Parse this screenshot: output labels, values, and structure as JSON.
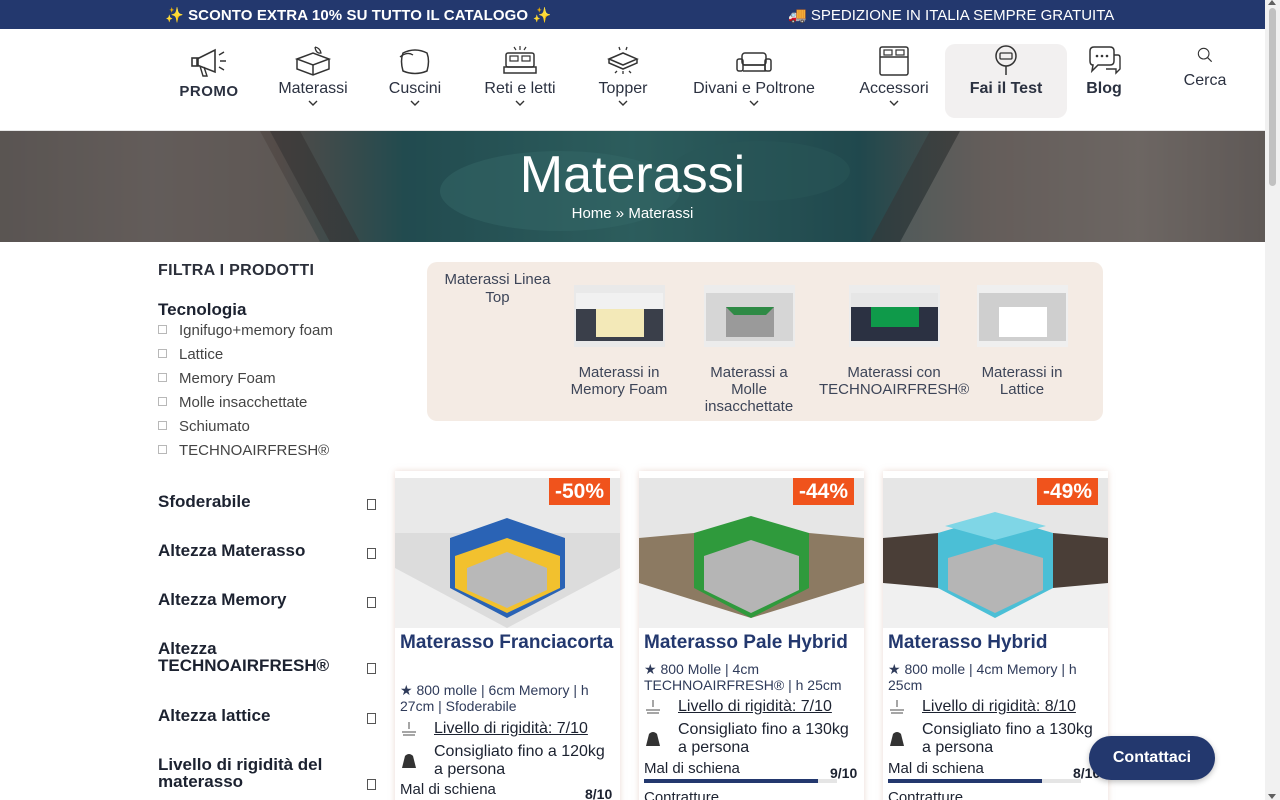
{
  "topbar": {
    "promo": "SCONTO EXTRA 10% SU TUTTO IL CATALOGO",
    "shipping": "SPEDIZIONE IN ITALIA SEMPRE GRATUITA",
    "spark": "✨",
    "truck": "🚚"
  },
  "nav": {
    "items": [
      {
        "label": "PROMO",
        "icon": "megaphone-icon"
      },
      {
        "label": "Materassi",
        "icon": "mattress-icon"
      },
      {
        "label": "Cuscini",
        "icon": "pillow-icon"
      },
      {
        "label": "Reti e letti",
        "icon": "bed-icon"
      },
      {
        "label": "Topper",
        "icon": "topper-icon"
      },
      {
        "label": "Divani e Poltrone",
        "icon": "sofa-icon"
      },
      {
        "label": "Accessori",
        "icon": "bed-frame-icon"
      },
      {
        "label": "Fai il Test",
        "icon": "sleep-test-icon"
      },
      {
        "label": "Blog",
        "icon": "chat-bubbles-icon"
      },
      {
        "label": "Cerca",
        "icon": "search-icon"
      }
    ]
  },
  "hero": {
    "title": "Materassi",
    "breadcrumb_home": "Home",
    "breadcrumb_sep": " » ",
    "breadcrumb_current": "Materassi"
  },
  "sidebar": {
    "title": "FILTRA I PRODOTTI",
    "technology": {
      "title": "Tecnologia",
      "options": [
        "Ignifugo+memory foam",
        "Lattice",
        "Memory Foam",
        "Molle insacchettate",
        "Schiumato",
        "TECHNOAIRFRESH®"
      ]
    },
    "facets": [
      "Sfoderabile",
      "Altezza Materasso",
      "Altezza Memory",
      "Altezza TECHNOAIRFRESH®",
      "Altezza lattice",
      "Livello di rigidità del materasso"
    ]
  },
  "categories": {
    "linea": "Materassi Linea Top",
    "items": [
      {
        "label": "Materassi in Memory Foam",
        "accent": "#f3e9b8"
      },
      {
        "label": "Materassi a Molle insacchettate",
        "accent": "#2e8a45"
      },
      {
        "label": "Materassi con TECHNOAIRFRESH®",
        "accent": "#0f9a4a"
      },
      {
        "label": "Materassi in Lattice",
        "accent": "#ffffff"
      }
    ]
  },
  "products": [
    {
      "discount": "-50%",
      "name": "Materasso Franciacorta",
      "spec": "★ 800 molle | 6cm Memory | h 27cm | Sfoderabile",
      "rigidity": "Livello di rigidità: 7/10",
      "weight": "Consigliato fino a 120kg a persona",
      "back_label": "Mal di schiena",
      "back_value": "8/10",
      "back_score": 0.8,
      "layer_color": "#2a63b5",
      "top_color": "#f2c12e"
    },
    {
      "discount": "-44%",
      "name": "Materasso Pale Hybrid",
      "spec": "★ 800 Molle | 4cm TECHNOAIRFRESH® | h 25cm",
      "rigidity": "Livello di rigidità: 7/10",
      "weight": "Consigliato fino a 130kg a persona",
      "back_label": "Mal di schiena",
      "back_value": "9/10",
      "back_score": 0.9,
      "extra_label": "Contratture",
      "layer_color": "#2f9a3c",
      "top_color": "#2f9a3c"
    },
    {
      "discount": "-49%",
      "name": "Materasso Hybrid",
      "spec": "★ 800 molle | 4cm Memory | h 25cm",
      "rigidity": "Livello di rigidità: 8/10",
      "weight": "Consigliato fino a 130kg a persona",
      "back_label": "Mal di schiena",
      "back_value": "8/10",
      "back_score": 0.8,
      "extra_label": "Contratture",
      "layer_color": "#4bbfd6",
      "top_color": "#7fd6e6"
    }
  ],
  "contact_label": "Contattaci",
  "colors": {
    "navy": "#23386e",
    "discount": "#f0531c",
    "category_bg": "#f4ebe4"
  }
}
